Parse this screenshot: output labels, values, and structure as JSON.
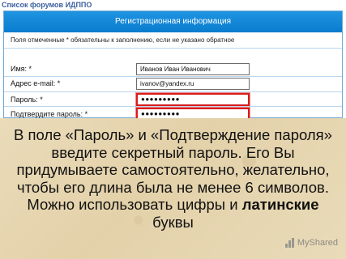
{
  "breadcrumb": "Список форумов ИДППО",
  "form": {
    "header": "Регистрационная информация",
    "note": "Поля отмеченные * обязательны к заполнению, если не указано обратное",
    "fields": [
      {
        "label": "Имя: *",
        "value": "Иванов Иван Иванович"
      },
      {
        "label": "Адрес e-mail: *",
        "value": "ivanov@yandex.ru"
      },
      {
        "label": "Пароль: *",
        "value": "●●●●●●●●●"
      },
      {
        "label": "Подтвердите пароль: *",
        "value": "●●●●●●●●●"
      }
    ]
  },
  "caption": {
    "part1": "В поле «Пароль» и «Подтверждение пароля» введите секретный пароль. Его Вы придумываете самостоятельно, желательно, чтобы его длина была не менее 6 символов. Можно использовать цифры и ",
    "bold": "латинские",
    "part2": " буквы"
  },
  "watermark": {
    "text": "MyShared",
    "icon": "bar-chart-icon"
  },
  "colors": {
    "header": "#0a7ccf",
    "highlight": "#d81c1c",
    "background": "#e7d8b4"
  }
}
